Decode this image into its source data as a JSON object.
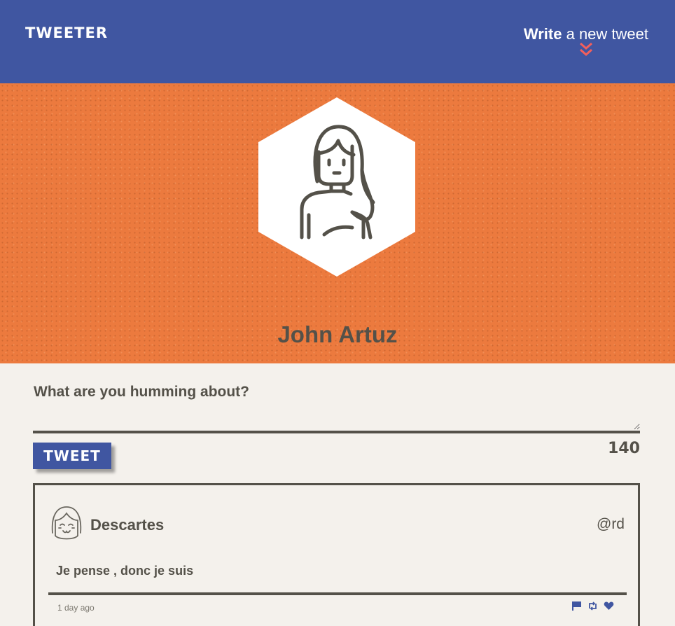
{
  "nav": {
    "brand": "TWEETER",
    "compose_strong": "Write",
    "compose_rest": "a new tweet",
    "chevron_icon": "double-chevron-down-icon",
    "chevron_color": "#f25f5c"
  },
  "profile": {
    "name": "John Artuz",
    "avatar_icon": "woman-avatar-icon"
  },
  "composer": {
    "label": "What are you humming about?",
    "input_value": "",
    "button_label": "TWEET",
    "counter": "140"
  },
  "tweets": [
    {
      "author": "Descartes",
      "handle": "@rd",
      "avatar_icon": "girl-avatar-icon",
      "text": "Je pense , donc je suis",
      "time": "1 day ago",
      "actions": [
        "flag-icon",
        "retweet-icon",
        "heart-icon"
      ]
    }
  ],
  "colors": {
    "nav": "#4056a1",
    "header": "#ec7a3e",
    "background": "#f4f1ec",
    "text": "#545149",
    "accent": "#f25f5c"
  }
}
